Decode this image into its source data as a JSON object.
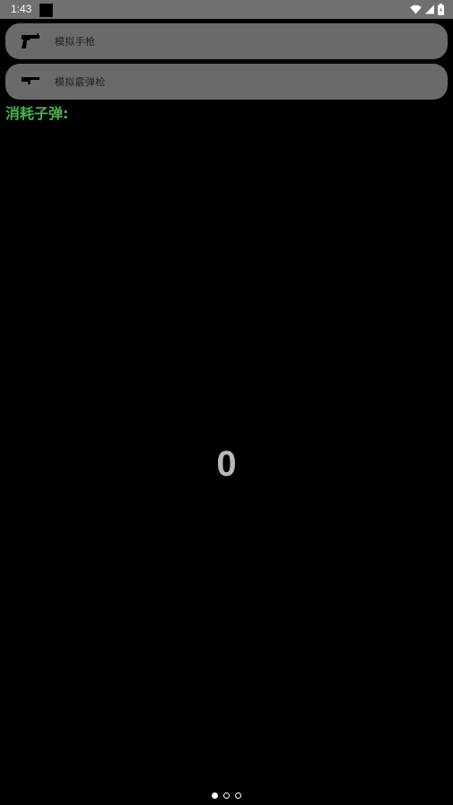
{
  "status_bar": {
    "time": "1:43",
    "icons": [
      "app-notification-icon",
      "wifi-icon",
      "signal-icon",
      "battery-icon"
    ]
  },
  "options": [
    {
      "icon": "pistol-icon",
      "label": "模拟手枪"
    },
    {
      "icon": "shotgun-icon",
      "label": "模拟霰弹枪"
    }
  ],
  "bullets": {
    "title": "消耗子弹:",
    "count": "0"
  },
  "pager": {
    "total_pages": 3,
    "active_page": 1
  },
  "colors": {
    "background": "#000000",
    "card": "#6a6a6a",
    "accent_green": "#4caf50",
    "counter_text": "#b8b8b8"
  }
}
